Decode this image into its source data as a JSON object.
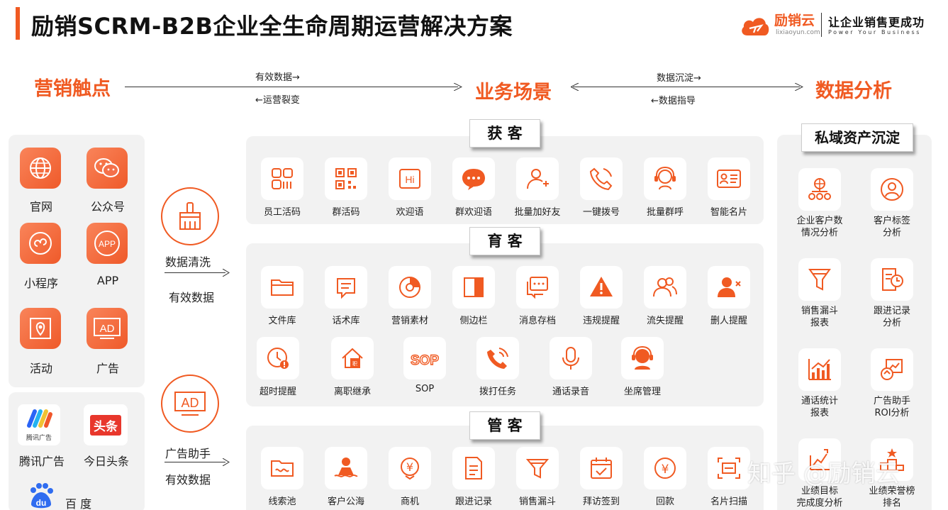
{
  "header": {
    "title": "励销SCRM-B2B企业全生命周期运营解决方案",
    "brand": "励销云",
    "brand_url": "lixiaoyun.com",
    "slogan": "让企业销售更成功",
    "slogan_en": "Power Your Business"
  },
  "flow": {
    "touch": "营销触点",
    "scene": "业务场景",
    "analysis": "数据分析",
    "arrow1_top": "有效数据→",
    "arrow1_bottom": "←运营裂变",
    "arrow2_top": "数据沉淀→",
    "arrow2_bottom": "←数据指导"
  },
  "channels": {
    "owned": [
      {
        "label": "官网",
        "icon": "globe-icon"
      },
      {
        "label": "公众号",
        "icon": "wechat-icon"
      },
      {
        "label": "小程序",
        "icon": "mini-program-icon"
      },
      {
        "label": "APP",
        "icon": "app-icon",
        "glyph": "APP"
      },
      {
        "label": "活动",
        "icon": "map-pin-icon"
      },
      {
        "label": "广告",
        "icon": "ad-icon",
        "glyph": "AD"
      }
    ],
    "ads": [
      {
        "label": "腾讯广告",
        "icon": "tencent-ads-logo",
        "logo_text": "腾讯广告"
      },
      {
        "label": "今日头条",
        "icon": "toutiao-logo",
        "logo_text": "头条"
      },
      {
        "label": "百 度",
        "icon": "baidu-logo",
        "logo_text": "du"
      }
    ]
  },
  "middle": {
    "clean_label": "数据清洗",
    "clean_sub": "有效数据",
    "ad_glyph": "AD",
    "ad_label": "广告助手",
    "ad_sub": "有效数据"
  },
  "acquire": {
    "title": "获 客",
    "items": [
      {
        "label": "员工活码",
        "icon": "qrcode-grid-icon"
      },
      {
        "label": "群活码",
        "icon": "qrcode-icon"
      },
      {
        "label": "欢迎语",
        "icon": "hi-icon",
        "glyph": "Hi"
      },
      {
        "label": "群欢迎语",
        "icon": "chat-bubble-icon"
      },
      {
        "label": "批量加好友",
        "icon": "add-user-icon"
      },
      {
        "label": "一键拨号",
        "icon": "phone-icon"
      },
      {
        "label": "批量群呼",
        "icon": "headset-icon"
      },
      {
        "label": "智能名片",
        "icon": "business-card-icon"
      }
    ]
  },
  "nurture": {
    "title": "育 客",
    "row1": [
      {
        "label": "文件库",
        "icon": "folder-icon"
      },
      {
        "label": "话术库",
        "icon": "script-icon"
      },
      {
        "label": "营销素材",
        "icon": "material-icon"
      },
      {
        "label": "侧边栏",
        "icon": "sidebar-icon"
      },
      {
        "label": "消息存档",
        "icon": "message-archive-icon"
      },
      {
        "label": "违规提醒",
        "icon": "warning-icon"
      },
      {
        "label": "流失提醒",
        "icon": "users-icon"
      },
      {
        "label": "删人提醒",
        "icon": "remove-user-icon"
      }
    ],
    "row2": [
      {
        "label": "超时提醒",
        "icon": "clock-alert-icon"
      },
      {
        "label": "离职继承",
        "icon": "inherit-icon"
      },
      {
        "label": "SOP",
        "icon": "sop-icon",
        "glyph": "SOP"
      },
      {
        "label": "拨打任务",
        "icon": "call-task-icon"
      },
      {
        "label": "通话录音",
        "icon": "microphone-icon"
      },
      {
        "label": "坐席管理",
        "icon": "agent-icon"
      }
    ]
  },
  "manage": {
    "title": "管 客",
    "items": [
      {
        "label": "线索池",
        "icon": "lead-pool-icon"
      },
      {
        "label": "客户公海",
        "icon": "customer-sea-icon"
      },
      {
        "label": "商机",
        "icon": "opportunity-icon",
        "glyph": "¥"
      },
      {
        "label": "跟进记录",
        "icon": "document-icon"
      },
      {
        "label": "销售漏斗",
        "icon": "funnel-icon"
      },
      {
        "label": "拜访签到",
        "icon": "calendar-check-icon"
      },
      {
        "label": "回款",
        "icon": "payment-icon",
        "glyph": "¥"
      },
      {
        "label": "名片扫描",
        "icon": "card-scan-icon"
      }
    ]
  },
  "private_assets": {
    "title": "私域资产沉淀",
    "items": [
      {
        "label": "企业客户数\n情况分析",
        "icon": "org-chart-icon"
      },
      {
        "label": "客户标签\n分析",
        "icon": "tag-user-icon"
      },
      {
        "label": "销售漏斗\n报表",
        "icon": "funnel-report-icon"
      },
      {
        "label": "跟进记录\n分析",
        "icon": "record-analysis-icon"
      },
      {
        "label": "通话统计\n报表",
        "icon": "bar-chart-icon"
      },
      {
        "label": "广告助手\nROI分析",
        "icon": "roi-icon"
      },
      {
        "label": "业绩目标\n完成度分析",
        "icon": "target-icon"
      },
      {
        "label": "业绩荣誉榜\n排名",
        "icon": "ranking-icon"
      }
    ]
  },
  "watermark": "知乎 @励销云",
  "colors": {
    "accent": "#f05a22",
    "panel": "#f2f2f2"
  }
}
